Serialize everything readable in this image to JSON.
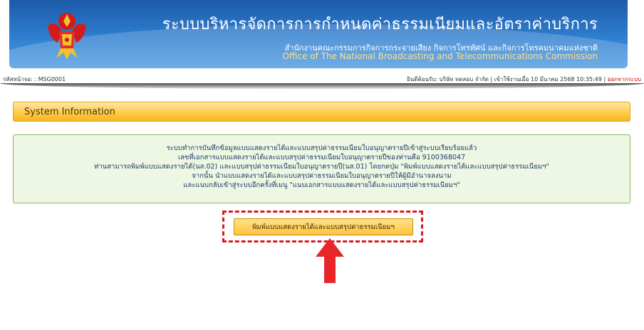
{
  "header": {
    "title": "ระบบบริหารจัดการการกำหนดค่าธรรมเนียมและอัตราค่าบริการ",
    "subtitle_th": "สำนักงานคณะกรรมการกิจการกระจายเสียง กิจการโทรทัศน์ และกิจการโทรคมนาคมแห่งชาติ",
    "subtitle_en": "Office of The National Broadcasting and Telecommunications Commission",
    "logo_icon": "garuda-emblem-icon"
  },
  "status_bar": {
    "page_code": "รหัสหน้าจอ: : MSG0001",
    "session_info": "ยินดีต้อนรับ: บริษัท ทดสอบ จำกัด | เข้าใช้งานเมื่อ 10 มีนาคม 2568 10:35:49 | ",
    "logout_label": "ออกจากระบบ"
  },
  "section": {
    "title": "System Information"
  },
  "message": {
    "lines": [
      "ระบบทำการบันทึกข้อมูลแบบแสดงรายได้และแบบสรุปค่าธรรมเนียมใบอนุญาตรายปีเข้าสู่ระบบเรียบร้อยแล้ว",
      "เลขที่เอกสารแบบแสดงรายได้และแบบสรุปค่าธรรมเนียมใบอนุญาตรายปีของท่านคือ 9100368047",
      "ท่านสามารถพิมพ์แบบแสดงรายได้(นส.02) และแบบสรุปค่าธรรมเนียมใบอนุญาตรายปี(นส.01) โดยกดปุ่ม \"พิมพ์แบบแสดงรายได้และแบบสรุปค่าธรรมเนียมฯ\"",
      "จากนั้น นำแบบแสดงรายได้และแบบสรุปค่าธรรมเนียมใบอนุญาตรายปีให้ผู้มีอำนาจลงนาม",
      "และแนบกลับเข้าสู่ระบบอีกครั้งที่เมนู \"แนบเอกสารแบบแสดงรายได้และแบบสรุปค่าธรรมเนียมฯ\""
    ]
  },
  "print_button": {
    "label": "พิมพ์แบบแสดงรายได้และแบบสรุปค่าธรรมเนียมฯ"
  },
  "colors": {
    "header_blue": "#2f7fd0",
    "accent_yellow": "#ffc940",
    "message_bg": "#eef7e4",
    "message_border": "#86b65a",
    "highlight_red": "#d9191f"
  }
}
